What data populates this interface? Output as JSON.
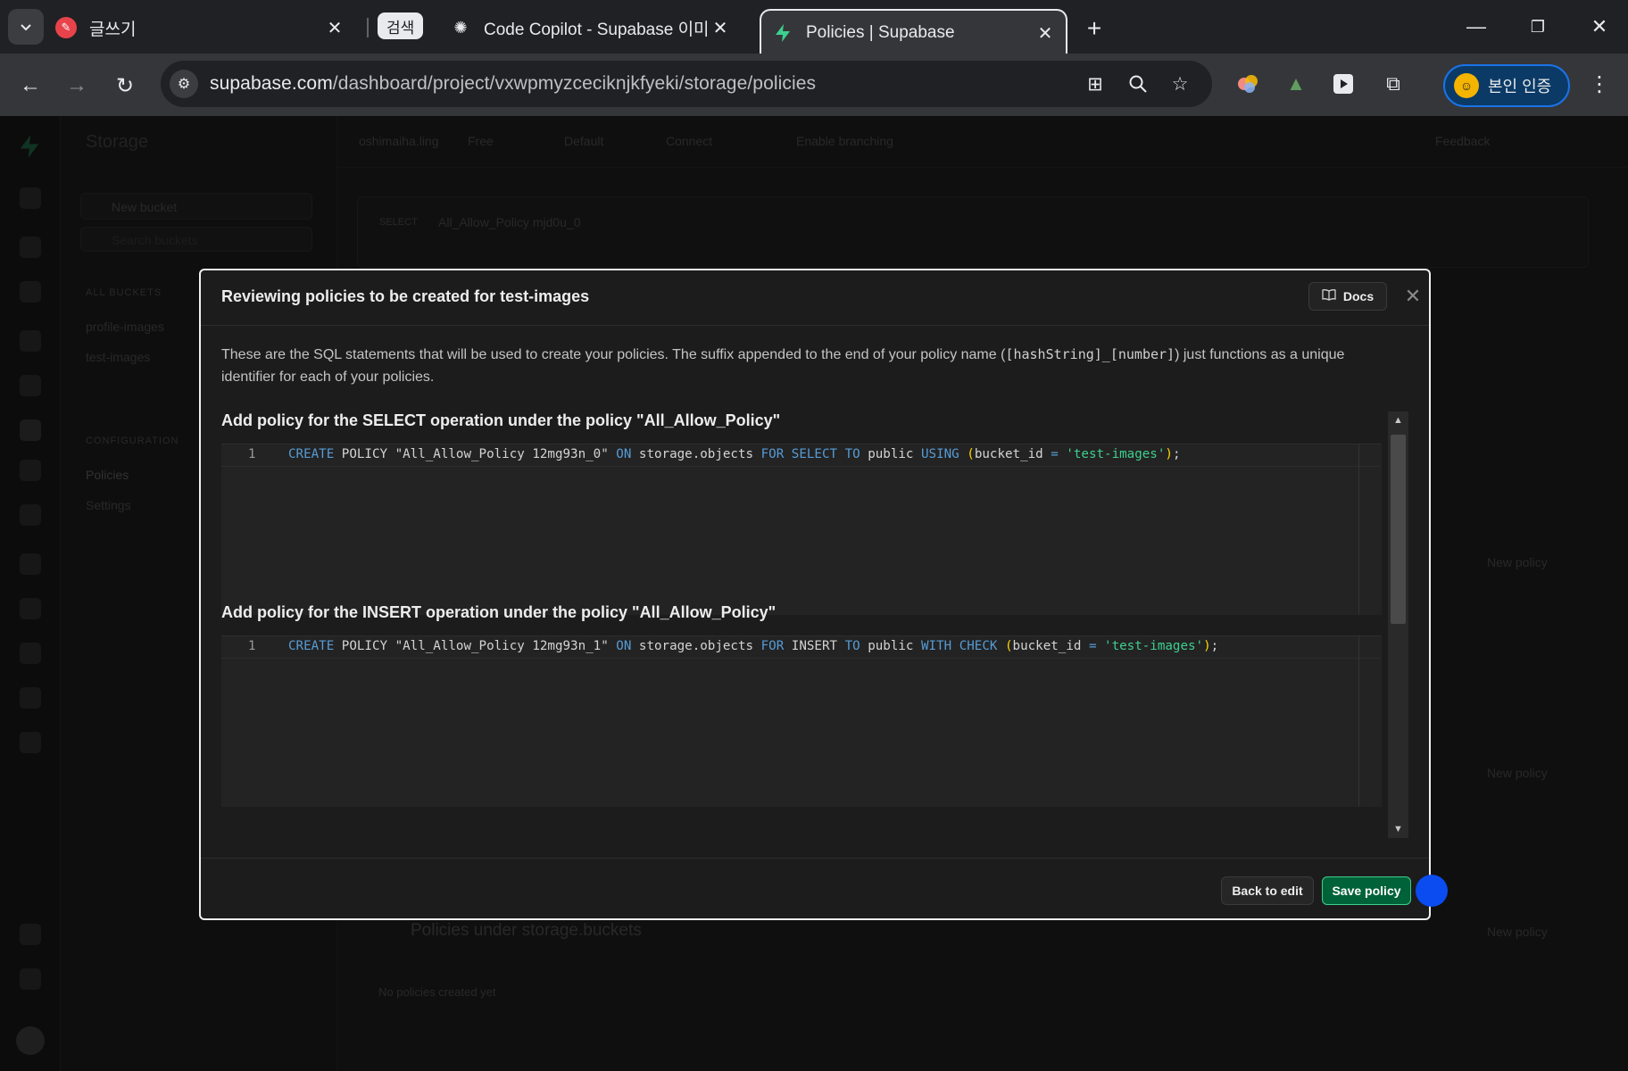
{
  "browser": {
    "tabs": [
      {
        "title": "글쓰기",
        "favicon": "pen-favicon"
      },
      {
        "title": "Code Copilot - Supabase 이미",
        "favicon": "openai-favicon",
        "chip": "검색"
      },
      {
        "title": "Policies | Supabase",
        "favicon": "supabase-favicon",
        "active": true
      }
    ],
    "address": {
      "host": "supabase.com",
      "path": "/dashboard/project/vxwpmyzceciknjkfyeki/storage/policies"
    },
    "profile_label": "본인 인증"
  },
  "background": {
    "app_title": "Storage",
    "new_bucket": "New bucket",
    "search_placeholder": "Search buckets",
    "all_buckets_heading": "ALL BUCKETS",
    "buckets": [
      "profile-images",
      "test-images"
    ],
    "config_heading": "CONFIGURATION",
    "config_items": [
      "Policies",
      "Settings"
    ],
    "header_crumbs": [
      "oshimaiha.ling",
      "Free",
      "Default",
      "Connect",
      "Enable branching"
    ],
    "feedback": "Feedback",
    "policy_row_label": "SELECT",
    "policy_row_name": "All_Allow_Policy mjd0u_0",
    "new_policy": "New policy",
    "buckets_section": "Policies under storage.buckets",
    "no_policies": "No policies created yet"
  },
  "modal": {
    "title": "Reviewing policies to be created for test-images",
    "docs_label": "Docs",
    "description_before": "These are the SQL statements that will be used to create your policies. The suffix appended to the end of your policy name (",
    "description_code": "[hashString]_[number]",
    "description_after": ") just functions as a unique identifier for each of your policies.",
    "sections": [
      {
        "title": "Add policy for the SELECT operation under the policy \"All_Allow_Policy\"",
        "line_number": "1",
        "tokens": [
          {
            "t": "CREATE",
            "c": "kw"
          },
          {
            "t": " POLICY \"All_Allow_Policy 12mg93n_0\" ",
            "c": ""
          },
          {
            "t": "ON",
            "c": "kw"
          },
          {
            "t": " storage.objects ",
            "c": ""
          },
          {
            "t": "FOR",
            "c": "kw"
          },
          {
            "t": " ",
            "c": ""
          },
          {
            "t": "SELECT",
            "c": "kw"
          },
          {
            "t": " ",
            "c": ""
          },
          {
            "t": "TO",
            "c": "kw"
          },
          {
            "t": " public ",
            "c": ""
          },
          {
            "t": "USING",
            "c": "kw"
          },
          {
            "t": " ",
            "c": ""
          },
          {
            "t": "(",
            "c": "paren"
          },
          {
            "t": "bucket_id ",
            "c": ""
          },
          {
            "t": "=",
            "c": "kw"
          },
          {
            "t": " ",
            "c": ""
          },
          {
            "t": "'test-images'",
            "c": "str"
          },
          {
            "t": ")",
            "c": "paren"
          },
          {
            "t": ";",
            "c": ""
          }
        ]
      },
      {
        "title": "Add policy for the INSERT operation under the policy \"All_Allow_Policy\"",
        "line_number": "1",
        "tokens": [
          {
            "t": "CREATE",
            "c": "kw"
          },
          {
            "t": " POLICY \"All_Allow_Policy 12mg93n_1\" ",
            "c": ""
          },
          {
            "t": "ON",
            "c": "kw"
          },
          {
            "t": " storage.objects ",
            "c": ""
          },
          {
            "t": "FOR",
            "c": "kw"
          },
          {
            "t": " INSERT ",
            "c": ""
          },
          {
            "t": "TO",
            "c": "kw"
          },
          {
            "t": " public ",
            "c": ""
          },
          {
            "t": "WITH CHECK",
            "c": "kw"
          },
          {
            "t": " ",
            "c": ""
          },
          {
            "t": "(",
            "c": "paren"
          },
          {
            "t": "bucket_id ",
            "c": ""
          },
          {
            "t": "=",
            "c": "kw"
          },
          {
            "t": " ",
            "c": ""
          },
          {
            "t": "'test-images'",
            "c": "str"
          },
          {
            "t": ")",
            "c": "paren"
          },
          {
            "t": ";",
            "c": ""
          }
        ]
      }
    ],
    "back_label": "Back to edit",
    "save_label": "Save policy"
  },
  "colors": {
    "brand": "#3ecf8e",
    "save_button": "#006239",
    "keyword": "#569cd6",
    "string": "#3ecf8e",
    "cursor": "#0a4cf0"
  }
}
